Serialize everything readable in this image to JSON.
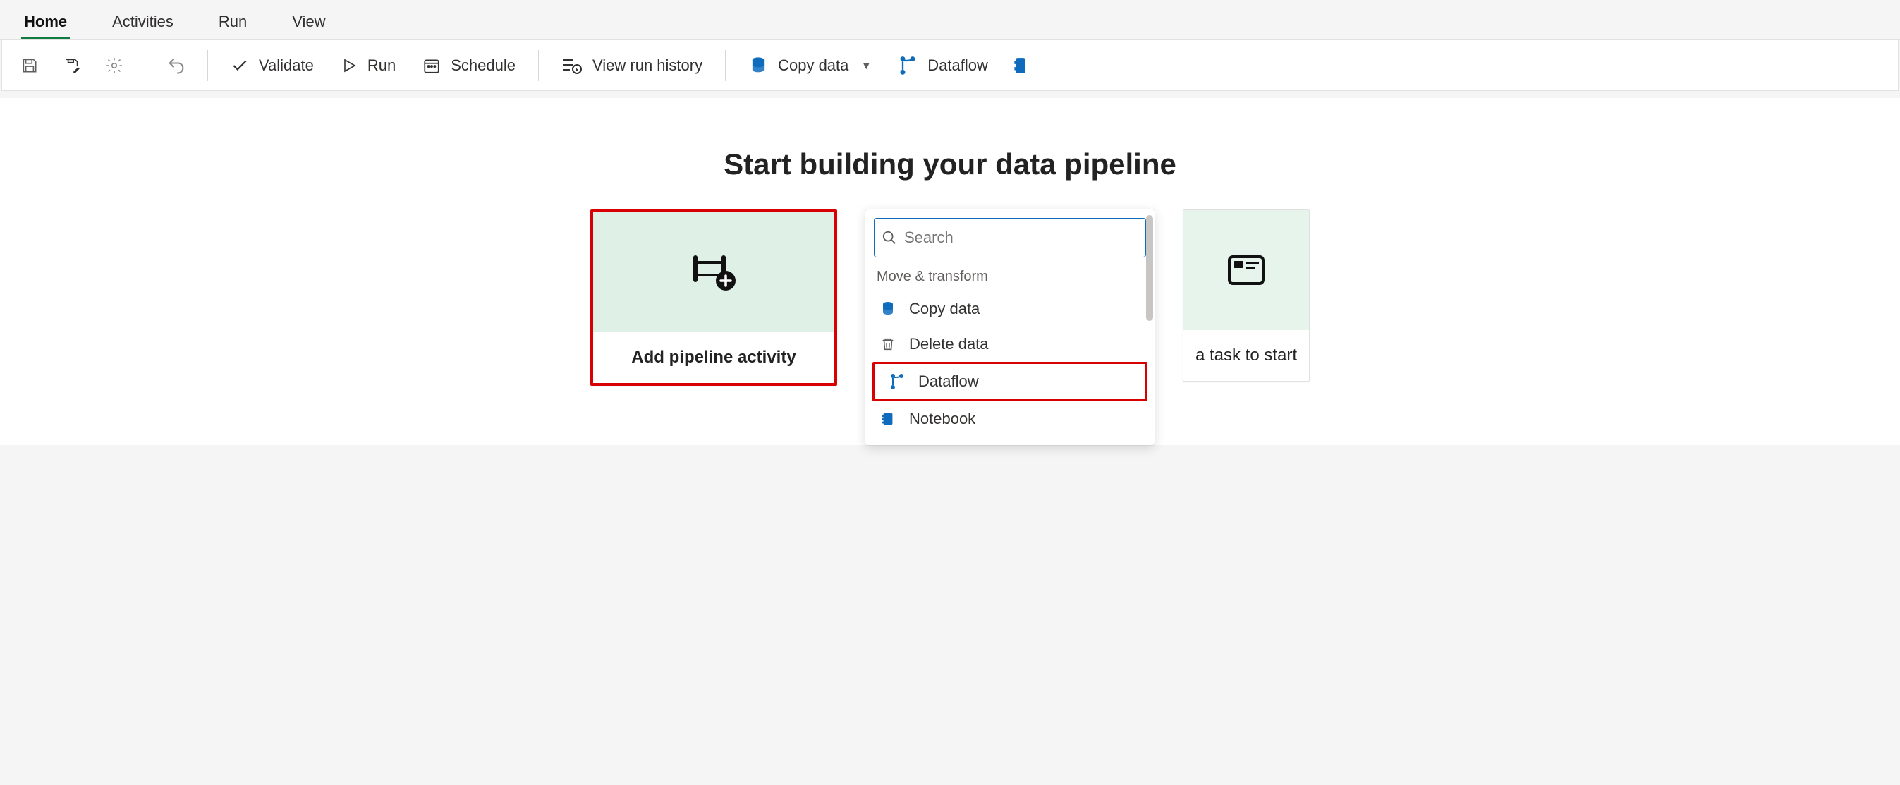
{
  "tabs": {
    "items": [
      "Home",
      "Activities",
      "Run",
      "View"
    ],
    "active": "Home"
  },
  "toolbar": {
    "validate": "Validate",
    "run": "Run",
    "schedule": "Schedule",
    "view_history": "View run history",
    "copy_data": "Copy data",
    "dataflow": "Dataflow"
  },
  "main": {
    "heading": "Start building your data pipeline"
  },
  "card_left": {
    "label": "Add pipeline activity"
  },
  "card_right": {
    "label": "a task to start"
  },
  "dropdown": {
    "search_placeholder": "Search",
    "section_title": "Move & transform",
    "items": {
      "copy_data": "Copy data",
      "delete_data": "Delete data",
      "dataflow": "Dataflow",
      "notebook": "Notebook"
    }
  }
}
